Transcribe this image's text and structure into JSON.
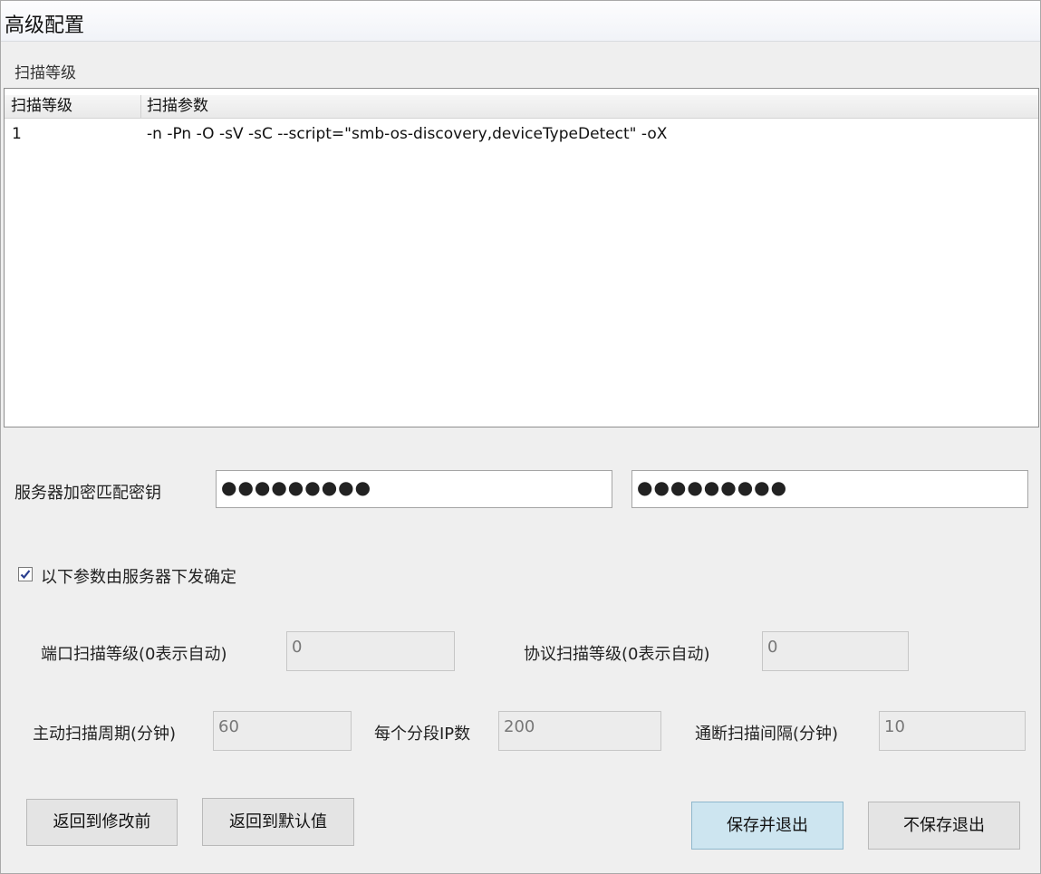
{
  "window": {
    "title": "高级配置"
  },
  "scan_level_section": {
    "label": "扫描等级",
    "columns": [
      "扫描等级",
      "扫描参数"
    ],
    "rows": [
      {
        "level": "1",
        "params": "-n -Pn -O -sV -sC --script=\"smb-os-discovery,deviceTypeDetect\" -oX"
      }
    ]
  },
  "server_key": {
    "label": "服务器加密匹配密钥",
    "value1": "●●●●●●●●●",
    "value2": "●●●●●●●●●"
  },
  "server_dispatch": {
    "checked": true,
    "label": "以下参数由服务器下发确定"
  },
  "params": {
    "port_scan_level": {
      "label": "端口扫描等级(0表示自动)",
      "value": "0"
    },
    "protocol_scan_level": {
      "label": "协议扫描等级(0表示自动)",
      "value": "0"
    },
    "active_scan_period": {
      "label": "主动扫描周期(分钟)",
      "value": "60"
    },
    "ips_per_segment": {
      "label": "每个分段IP数",
      "value": "200"
    },
    "connectivity_interval": {
      "label": "通断扫描间隔(分钟)",
      "value": "10"
    }
  },
  "buttons": {
    "revert_label": "返回到修改前",
    "default_label": "返回到默认值",
    "save_exit_label": "保存并退出",
    "exit_no_save_label": "不保存退出"
  },
  "colors": {
    "primary_button": "#cde5f0",
    "background": "#efefef"
  }
}
